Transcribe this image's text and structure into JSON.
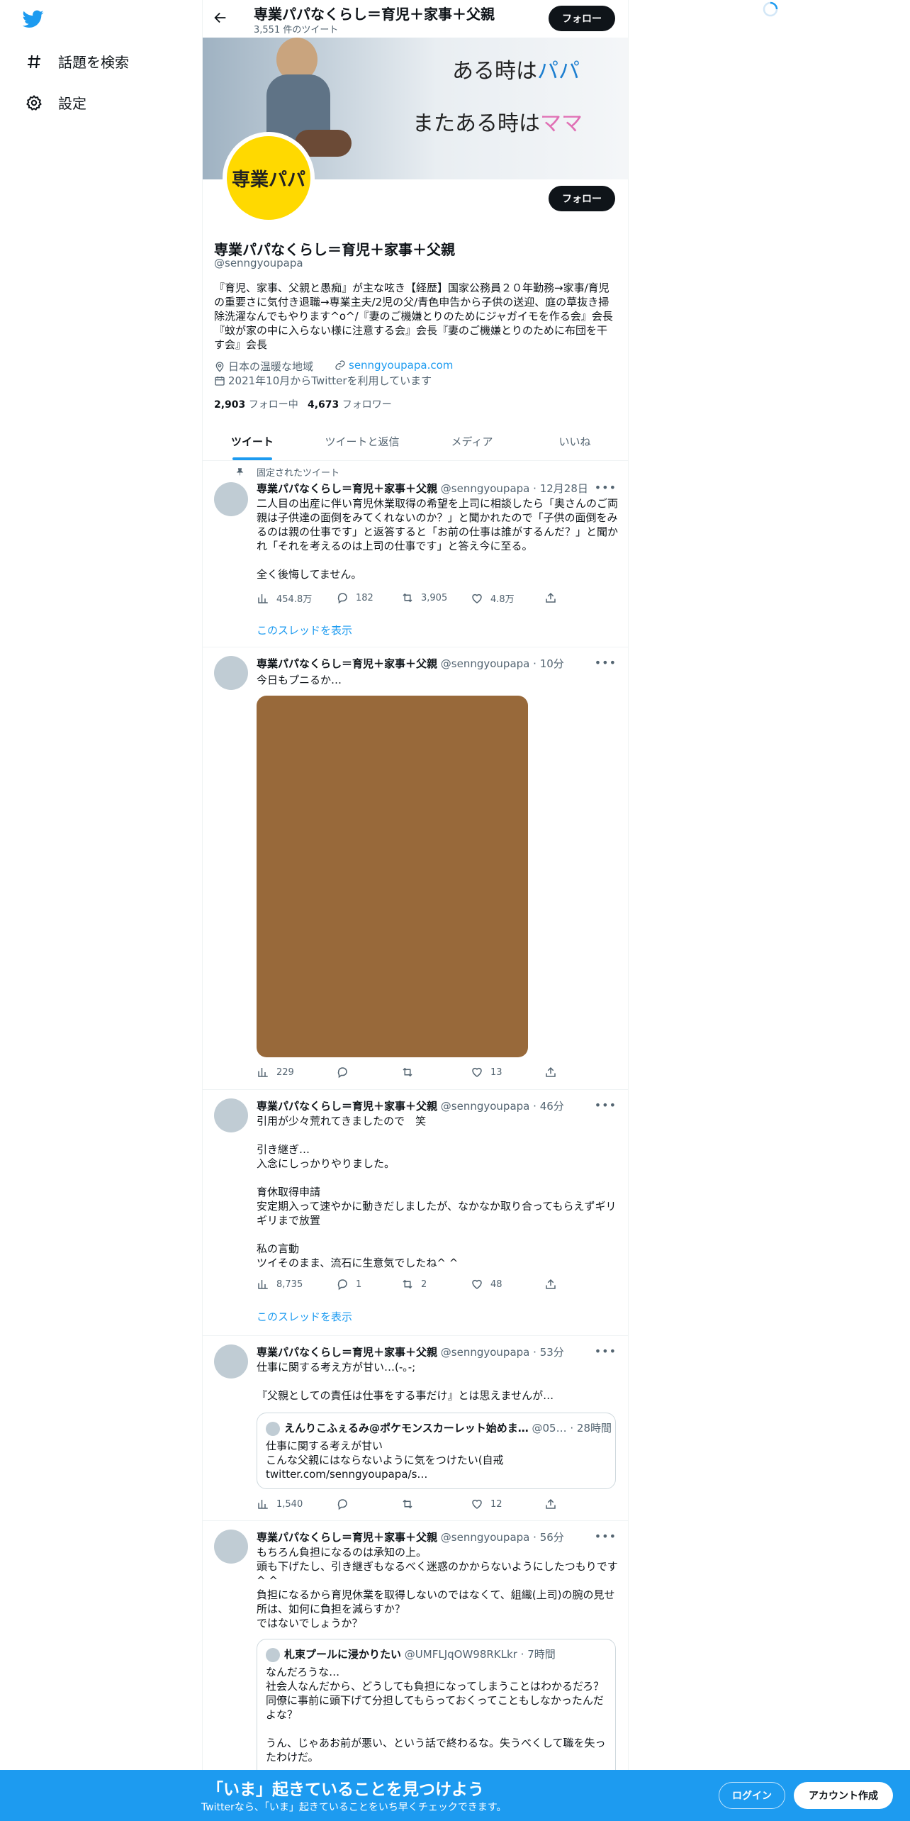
{
  "nav": {
    "explore_label": "話題を検索",
    "settings_label": "設定"
  },
  "header": {
    "title": "専業パパなくらし＝育児＋家事＋父親",
    "tweet_count": "3,551 件のツイート",
    "follow_label": "フォロー"
  },
  "banner_image": {
    "line1_a": "ある時は",
    "line1_b": "パパ",
    "line2_a": "またある時は",
    "line2_b": "ママ"
  },
  "profile": {
    "avatar_text": "専業パパ",
    "follow_label": "フォロー",
    "name": "専業パパなくらし＝育児＋家事＋父親",
    "handle": "@senngyoupapa",
    "bio": "『育児、家事、父親と愚痴』が主な呟き【経歴】国家公務員２０年勤務→家事/育児の重要さに気付き退職→専業主夫/2児の父/青色申告から子供の送迎、庭の草抜き掃除洗濯なんでもやります^o^/『妻のご機嫌とりのためにジャガイモを作る会』会長『蚊が家の中に入らない様に注意する会』会長『妻のご機嫌とりのために布団を干す会』会長",
    "location": "日本の温暖な地域",
    "website": "senngyoupapa.com",
    "joined": "2021年10月からTwitterを利用しています",
    "following_count": "2,903",
    "following_label": "フォロー中",
    "followers_count": "4,673",
    "followers_label": "フォロワー"
  },
  "tabs": [
    "ツイート",
    "ツイートと返信",
    "メディア",
    "いいね"
  ],
  "tweets": [
    {
      "pinned_label": "固定されたツイート",
      "name": "専業パパなくらし＝育児＋家事＋父親",
      "handle": "@senngyoupapa",
      "time": "12月28日",
      "text": "二人目の出産に伴い育児休業取得の希望を上司に相談したら「奥さんのご両親は子供達の面倒をみてくれないのか？」と聞かれたので「子供の面倒をみるのは親の仕事です」と返答すると「お前の仕事は誰がするんだ？」と聞かれ「それを考えるのは上司の仕事です」と答え今に至る。\n\n全く後悔してません。",
      "views": "454.8万",
      "replies": "182",
      "retweets": "3,905",
      "likes": "4.8万",
      "thread_link": "このスレッドを表示"
    },
    {
      "name": "専業パパなくらし＝育児＋家事＋父親",
      "handle": "@senngyoupapa",
      "time": "10分",
      "text": "今日もプニるか…",
      "media_color": "#98693a",
      "views": "229",
      "replies": "",
      "retweets": "",
      "likes": "13"
    },
    {
      "name": "専業パパなくらし＝育児＋家事＋父親",
      "handle": "@senngyoupapa",
      "time": "46分",
      "text": "引用が少々荒れてきましたので　笑\n\n引き継ぎ…\n入念にしっかりやりました。\n\n育休取得申請\n安定期入って速やかに動きだしましたが、なかなか取り合ってもらえずギリギリまで放置\n\n私の言動\nツイそのまま、流石に生意気でしたね^ ^",
      "views": "8,735",
      "replies": "1",
      "retweets": "2",
      "likes": "48",
      "thread_link": "このスレッドを表示"
    },
    {
      "name": "専業パパなくらし＝育児＋家事＋父親",
      "handle": "@senngyoupapa",
      "time": "53分",
      "text": "仕事に関する考え方が甘い…(-｡-;\n\n『父親としての責任は仕事をする事だけ』とは思えませんが…",
      "quote": {
        "name": "えんりこふぇるみ@ポケモンスカーレット始めま…",
        "handle": "@05…",
        "time": "28時間",
        "text": "仕事に関する考えが甘い\nこんな父親にはならないように気をつけたい(自戒\ntwitter.com/senngyoupapa/s…"
      },
      "views": "1,540",
      "replies": "",
      "retweets": "",
      "likes": "12"
    },
    {
      "name": "専業パパなくらし＝育児＋家事＋父親",
      "handle": "@senngyoupapa",
      "time": "56分",
      "text": "もちろん負担になるのは承知の上。\n頭も下げたし、引き継ぎもなるべく迷惑のかからないようにしたつもりです^ ^\n負担になるから育児休業を取得しないのではなくて、組織(上司)の腕の見せ所は、如何に負担を減らすか？\nではないでしょうか？",
      "quote": {
        "name": "札束プールに浸かりたい",
        "handle": "@UMFLJqOW98RKLkr",
        "time": "7時間",
        "text": "なんだろうな…\n社会人なんだから、どうしても負担になってしまうことはわかるだろ？同僚に事前に頭下げて分担してもらっておくってこともしなかったんだよな？\n\nうん、じゃあお前が悪い、という話で終わるな。失うべくして職を失ったわけだ。"
      }
    }
  ],
  "bottom_banner": {
    "headline": "「いま」起きていることを見つけよう",
    "sub": "Twitterなら、「いま」起きていることをいち早くチェックできます。",
    "login_label": "ログイン",
    "signup_label": "アカウント作成"
  },
  "colors": {
    "accent": "#1d9bf0",
    "text": "#0f1419",
    "muted": "#536471",
    "avatar_yellow": "#ffd900"
  }
}
